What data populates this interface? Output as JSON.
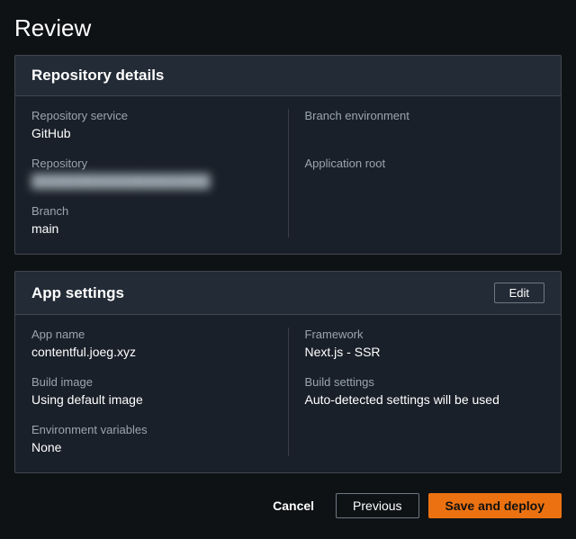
{
  "page": {
    "title": "Review"
  },
  "repo_panel": {
    "title": "Repository details",
    "service_label": "Repository service",
    "service_value": "GitHub",
    "repo_label": "Repository",
    "repo_value": "████████████████████",
    "branch_label": "Branch",
    "branch_value": "main",
    "branch_env_label": "Branch environment",
    "branch_env_value": "",
    "app_root_label": "Application root",
    "app_root_value": ""
  },
  "app_panel": {
    "title": "App settings",
    "edit_label": "Edit",
    "app_name_label": "App name",
    "app_name_value": "contentful.joeg.xyz",
    "build_image_label": "Build image",
    "build_image_value": "Using default image",
    "env_vars_label": "Environment variables",
    "env_vars_value": "None",
    "framework_label": "Framework",
    "framework_value": "Next.js - SSR",
    "build_settings_label": "Build settings",
    "build_settings_value": "Auto-detected settings will be used"
  },
  "footer": {
    "cancel": "Cancel",
    "previous": "Previous",
    "save_deploy": "Save and deploy"
  }
}
